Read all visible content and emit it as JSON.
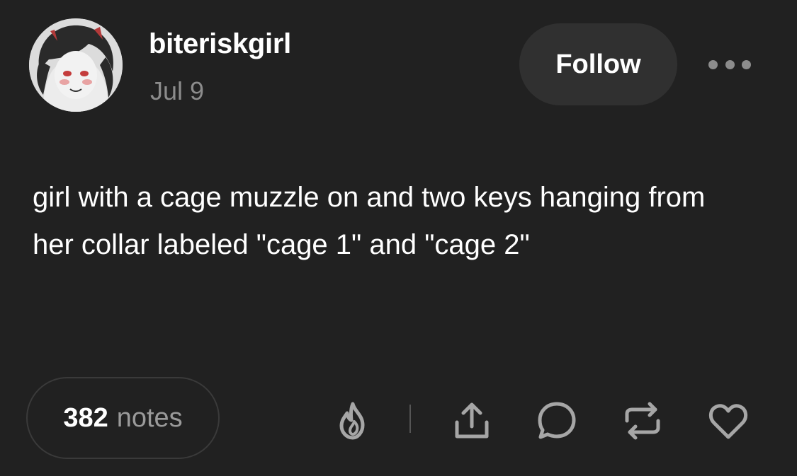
{
  "post": {
    "username": "biteriskgirl",
    "date": "Jul 9",
    "follow_label": "Follow",
    "body": "girl with a cage muzzle on and two keys hanging from her collar labeled \"cage 1\" and \"cage 2\""
  },
  "footer": {
    "notes_count": "382",
    "notes_label": "notes"
  },
  "icons": {
    "more": "more-dots-icon",
    "blaze": "flame-icon",
    "share": "share-icon",
    "reply": "speech-bubble-icon",
    "reblog": "reblog-icon",
    "like": "heart-icon"
  },
  "colors": {
    "background": "#212121",
    "follow_button": "#303030",
    "muted_text": "#8c8c8c",
    "icon": "#a6a6a6"
  }
}
